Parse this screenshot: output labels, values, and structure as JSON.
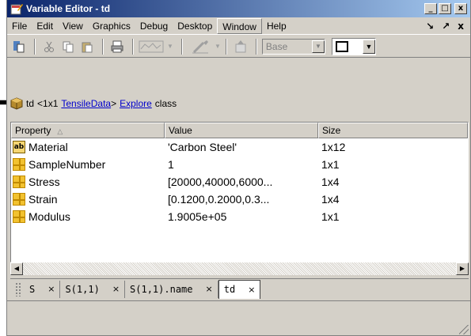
{
  "window": {
    "title": "Variable Editor - td",
    "min_label": "_",
    "max_label": "□",
    "close_label": "x"
  },
  "menus": [
    "File",
    "Edit",
    "View",
    "Graphics",
    "Debug",
    "Desktop",
    "Window",
    "Help"
  ],
  "menu_right": {
    "undock": "↘",
    "dock": "↗",
    "close": "x"
  },
  "toolbar": {
    "base_label": "Base",
    "icons": [
      "variable-icon",
      "cut-icon",
      "copy-icon",
      "paste-icon",
      "print-icon",
      "plot-icon",
      "brush-icon",
      "import-icon"
    ]
  },
  "breadcrumb": {
    "name": "td",
    "size": "<1x1",
    "class_link": "TensileData",
    "gt": ">",
    "explore_link": "Explore",
    "suffix": "class"
  },
  "table": {
    "headers": {
      "property": "Property",
      "value": "Value",
      "size": "Size"
    },
    "rows": [
      {
        "icon": "char-icon",
        "property": "Material",
        "value": "'Carbon Steel'",
        "size": "1x12"
      },
      {
        "icon": "numeric-icon",
        "property": "SampleNumber",
        "value": "1",
        "size": "1x1"
      },
      {
        "icon": "numeric-icon",
        "property": "Stress",
        "value": "[20000,40000,6000...",
        "size": "1x4"
      },
      {
        "icon": "numeric-icon",
        "property": "Strain",
        "value": "[0.1200,0.2000,0.3...",
        "size": "1x4"
      },
      {
        "icon": "numeric-icon",
        "property": "Modulus",
        "value": "1.9005e+05",
        "size": "1x1"
      }
    ]
  },
  "tabs": [
    {
      "label": "S",
      "close": "×"
    },
    {
      "label": "S(1,1)",
      "close": "×"
    },
    {
      "label": "S(1,1).name",
      "close": "×"
    },
    {
      "label": "td",
      "close": "×",
      "active": true
    }
  ],
  "colors": {
    "titlebar_start": "#0a246a",
    "titlebar_end": "#a6caf0",
    "link": "#0000cc",
    "chrome": "#d4d0c8"
  }
}
